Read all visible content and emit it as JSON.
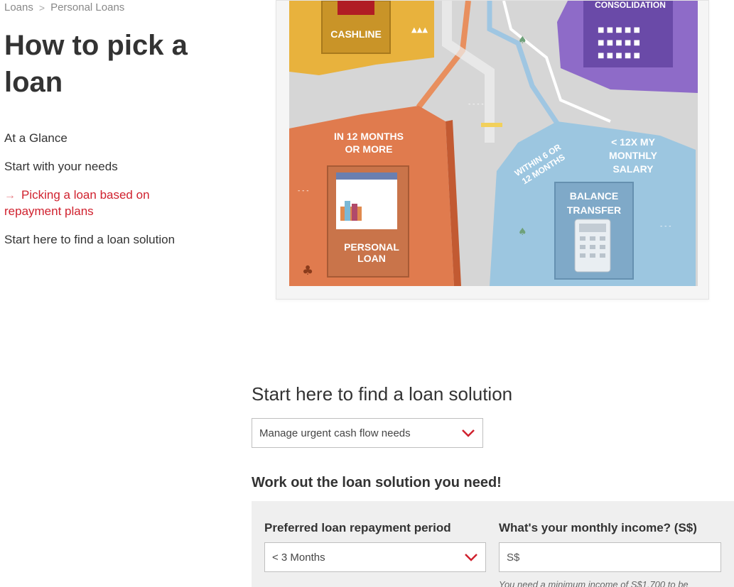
{
  "breadcrumb": {
    "items": [
      "Loans",
      "Personal Loans"
    ],
    "separator": ">"
  },
  "page": {
    "title": "How to pick a loan"
  },
  "side_nav": {
    "items": [
      {
        "label": "At a Glance",
        "active": false
      },
      {
        "label": "Start with your needs",
        "active": false
      },
      {
        "label": "Picking a loan based on repayment plans",
        "active": true
      },
      {
        "label": "Start here to find a loan solution",
        "active": false
      }
    ],
    "arrow": "→"
  },
  "infographic": {
    "cashline": "CASHLINE",
    "consolidation": "CONSOLIDATION",
    "months_line1": "IN 12 MONTHS",
    "months_line2": "OR MORE",
    "personal_loan_line1": "PERSONAL",
    "personal_loan_line2": "LOAN",
    "within_line1": "WITHIN 6 OR",
    "within_line2": "12 MONTHS",
    "salary_line1": "< 12X MY",
    "salary_line2": "MONTHLY",
    "salary_line3": "SALARY",
    "balance_line1": "BALANCE",
    "balance_line2": "TRANSFER"
  },
  "finder": {
    "title": "Start here to find a loan solution",
    "need_select_value": "Manage urgent cash flow needs",
    "subtitle": "Work out the loan solution you need!",
    "period_label": "Preferred loan repayment period",
    "period_value": "< 3 Months",
    "income_label": "What's your monthly income? (S$)",
    "income_placeholder": "S$",
    "income_hint": "You need a minimum income of S$1,700 to be"
  },
  "colors": {
    "accent_red": "#d0212e",
    "cashline_yellow": "#e8b23d",
    "consolidation_purple": "#8e6bc8",
    "personal_orange": "#e07b4e",
    "balance_blue": "#9cc6e0"
  }
}
